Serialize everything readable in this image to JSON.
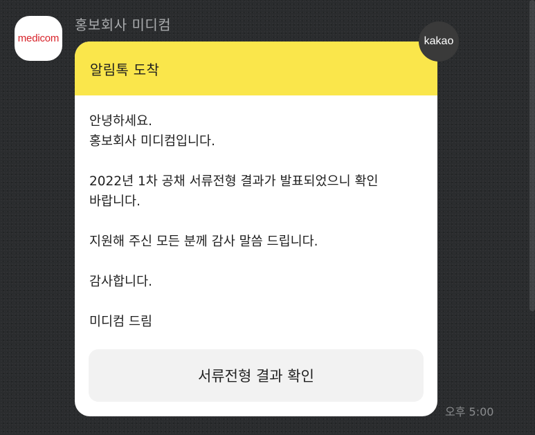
{
  "sender": {
    "name": "홍보회사 미디컴",
    "avatar_logo": "medicom"
  },
  "badge": {
    "label": "kakao"
  },
  "message": {
    "header_title": "알림톡 도착",
    "lines": [
      "안녕하세요.",
      "홍보회사 미디컴입니다.",
      "",
      "2022년 1차 공채 서류전형 결과가 발표되었으니 확인",
      "바랍니다.",
      "",
      "지원해 주신 모든 분께 감사 말씀 드립니다.",
      "",
      "감사합니다.",
      "",
      "미디컴 드림"
    ],
    "button_label": "서류전형 결과 확인",
    "timestamp": "오후 5:00"
  },
  "colors": {
    "header_yellow": "#fae64b",
    "background": "#2a2c2e",
    "logo_red": "#d8232a"
  }
}
